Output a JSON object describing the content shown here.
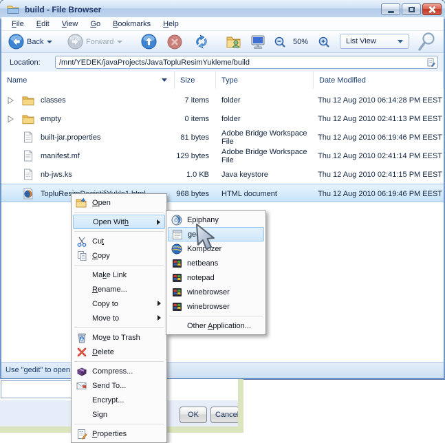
{
  "window": {
    "title": "build - File Browser"
  },
  "menubar": {
    "items": [
      "File",
      "Edit",
      "View",
      "Go",
      "Bookmarks",
      "Help"
    ]
  },
  "toolbar": {
    "back_label": "Back",
    "forward_label": "Forward",
    "zoom_level": "50%",
    "view_mode": "List View"
  },
  "location_bar": {
    "label": "Location:",
    "value": "/mnt/YEDEK/javaProjects/JavaTopluResimYukleme/build"
  },
  "columns": [
    "Name",
    "Size",
    "Type",
    "Date Modified"
  ],
  "files": [
    {
      "name": "classes",
      "size": "7 items",
      "type": "folder",
      "modified": "Thu 12 Aug 2010 06:14:28 PM EEST",
      "icon": "folder",
      "expandable": true
    },
    {
      "name": "empty",
      "size": "0 items",
      "type": "folder",
      "modified": "Thu 12 Aug 2010 02:41:13 PM EEST",
      "icon": "folder",
      "expandable": true
    },
    {
      "name": "built-jar.properties",
      "size": "81 bytes",
      "type": "Adobe Bridge Workspace File",
      "modified": "Thu 12 Aug 2010 06:19:46 PM EEST",
      "icon": "document"
    },
    {
      "name": "manifest.mf",
      "size": "129 bytes",
      "type": "Adobe Bridge Workspace File",
      "modified": "Thu 12 Aug 2010 02:41:14 PM EEST",
      "icon": "document"
    },
    {
      "name": "nb-jws.ks",
      "size": "1.0 KB",
      "type": "Java keystore",
      "modified": "Thu 12 Aug 2010 02:41:15 PM EEST",
      "icon": "document"
    },
    {
      "name": "TopluResimDegistiliYukle1.html",
      "size": "968 bytes",
      "type": "HTML document",
      "modified": "Thu 12 Aug 2010 06:19:46 PM EEST",
      "icon": "firefox-html",
      "selected": true
    }
  ],
  "statusbar": {
    "text": "Use \"gedit\" to open"
  },
  "context_menu": {
    "items": [
      {
        "label": "Open",
        "icon": "open-folder-icon",
        "accel": 0
      },
      {
        "separator": true
      },
      {
        "label": "Open With",
        "submenu": true,
        "highlight": true,
        "accel": 8
      },
      {
        "separator": true
      },
      {
        "label": "Cut",
        "icon": "scissors-icon",
        "accel": 2
      },
      {
        "label": "Copy",
        "icon": "copy-icon",
        "accel": 0
      },
      {
        "separator": true
      },
      {
        "label": "Make Link",
        "accel": 2
      },
      {
        "label": "Rename...",
        "accel": 0
      },
      {
        "label": "Copy to",
        "submenu": true
      },
      {
        "label": "Move to",
        "submenu": true
      },
      {
        "separator": true
      },
      {
        "label": "Move to Trash",
        "icon": "trash-icon",
        "accel": 2
      },
      {
        "label": "Delete",
        "icon": "delete-icon",
        "accel": 0
      },
      {
        "separator": true
      },
      {
        "label": "Compress...",
        "icon": "compress-icon"
      },
      {
        "label": "Send To...",
        "icon": "send-icon"
      },
      {
        "label": "Encrypt..."
      },
      {
        "label": "Sign"
      },
      {
        "separator": true
      },
      {
        "label": "Properties",
        "icon": "properties-icon",
        "accel": 0
      }
    ]
  },
  "open_with_submenu": {
    "items": [
      {
        "label": "Epiphany",
        "icon": "epiphany-icon"
      },
      {
        "label": "gedit",
        "icon": "gedit-icon",
        "highlight": true
      },
      {
        "label": "Kompozer",
        "icon": "kompozer-icon"
      },
      {
        "label": "netbeans",
        "icon": "wine-app-icon"
      },
      {
        "label": "notepad",
        "icon": "wine-app-icon"
      },
      {
        "label": "winebrowser",
        "icon": "wine-app-icon"
      },
      {
        "label": "winebrowser",
        "icon": "wine-app-icon"
      },
      {
        "separator": true
      },
      {
        "label": "Other Application...",
        "accel": 6
      }
    ]
  },
  "dialog": {
    "ok_label": "OK",
    "cancel_label": "Cancel"
  }
}
